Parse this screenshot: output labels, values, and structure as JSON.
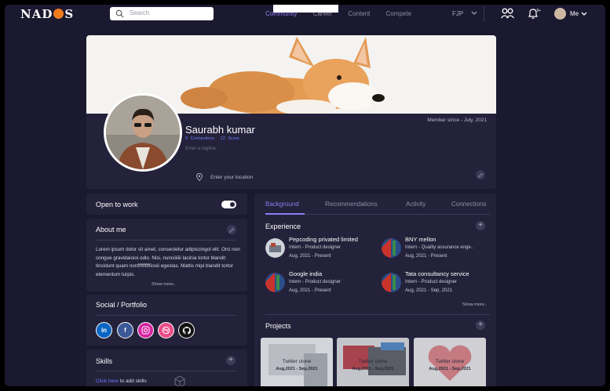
{
  "nav": {
    "logo": "NADOS",
    "search_placeholder": "Search",
    "links": [
      "Community",
      "Career",
      "Content",
      "Compete"
    ],
    "active_link": "Community",
    "org": "FJP",
    "me_label": "Me"
  },
  "profile": {
    "name": "Saurabh kumar",
    "connections_count": "0",
    "connections_label": "Connections",
    "score_count": "12",
    "score_label": "Score",
    "tagline_placeholder": "Enter a tagline.",
    "member_since": "Member since - July, 2021",
    "location_placeholder": "Enter your location"
  },
  "open_to_work": {
    "label": "Open to work",
    "enabled": true
  },
  "about": {
    "title": "About me",
    "text": "Lorem ipsum dolor sit amet, consectetur adipiscingol elit. Orci non congue gravidaioioi odio. Nisi, nunciiiiiii lacinia tortor blandit tincidunt quam nonffffffffffiooii egestas. Mattis mipi blandit tortor elementum turpis.",
    "show_more": "Show more.."
  },
  "social": {
    "title": "Social / Portfolio",
    "icons": [
      "linkedin-icon",
      "facebook-icon",
      "instagram-icon",
      "dribbble-icon",
      "github-icon"
    ]
  },
  "skills": {
    "title": "Skills",
    "link": "Click here",
    "suffix": " to add skills"
  },
  "tabs": {
    "items": [
      "Background",
      "Recommendations",
      "Activity",
      "Connections"
    ],
    "active": "Background"
  },
  "experience": {
    "title": "Experience",
    "items": [
      {
        "company": "Pepcoding privated limited",
        "role": "Intern - Product designer",
        "dates": "Aug, 2021 - Present"
      },
      {
        "company": "BNY mellon",
        "role": "Intern - Quality assurance enge..",
        "dates": "Aug, 2021 - Present"
      },
      {
        "company": "Google india",
        "role": "Intern - Product designer",
        "dates": "Aug, 2021 - Present"
      },
      {
        "company": "Tata consultancy service",
        "role": "Intern - Product designer",
        "dates": "Aug, 2021 - Sep, 2021"
      }
    ],
    "show_more": "Show more.."
  },
  "projects": {
    "title": "Projects",
    "items": [
      {
        "title": "Twitter clone",
        "dates": "Aug,2021 - Sep,2021"
      },
      {
        "title": "Twitter clone",
        "dates": "Aug,2021 - Sep,2021"
      },
      {
        "title": "Twitter clone",
        "dates": "Aug,2021 - Sep,2021"
      }
    ]
  },
  "colors": {
    "accent": "#8c7cf0",
    "link": "#6e7bff",
    "background": "#1b1930",
    "panel": "#24223a"
  }
}
